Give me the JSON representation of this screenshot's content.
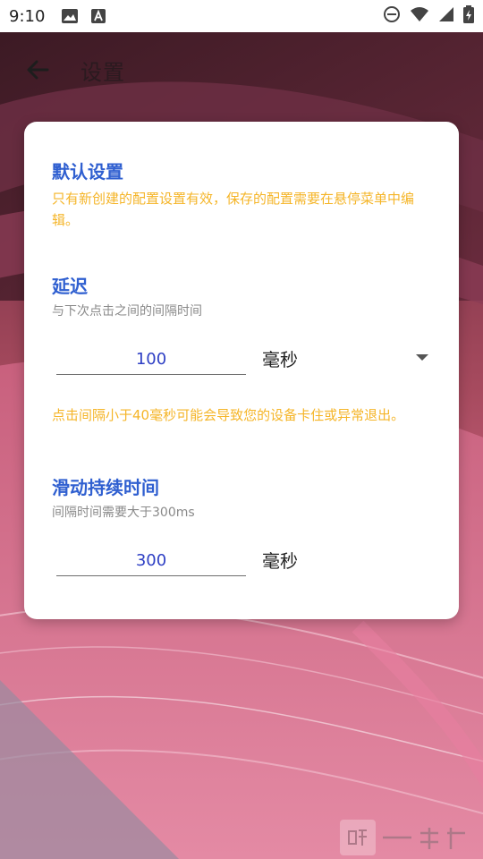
{
  "status_bar": {
    "time": "9:10",
    "icons": [
      "image-icon",
      "text-a-icon",
      "do-not-disturb-icon",
      "wifi-icon",
      "signal-icon",
      "battery-charging-icon"
    ]
  },
  "app_bar": {
    "title": "设置",
    "back_icon": "arrow-back-icon"
  },
  "card": {
    "default_section": {
      "title": "默认设置",
      "note": "只有新创建的配置设置有效，保存的配置需要在悬停菜单中编辑。"
    },
    "delay_section": {
      "title": "延迟",
      "hint": "与下次点击之间的间隔时间",
      "value": "100",
      "unit": "毫秒",
      "warning": "点击间隔小于40毫秒可能会导致您的设备卡住或异常退出。"
    },
    "swipe_section": {
      "title": "滑动持续时间",
      "hint": "间隔时间需要大于300ms",
      "value": "300",
      "unit": "毫秒"
    }
  },
  "colors": {
    "section_title": "#2f5fd0",
    "warning": "#f5b528",
    "hint": "#8a8a8a",
    "input_text": "#2e3fc4"
  }
}
